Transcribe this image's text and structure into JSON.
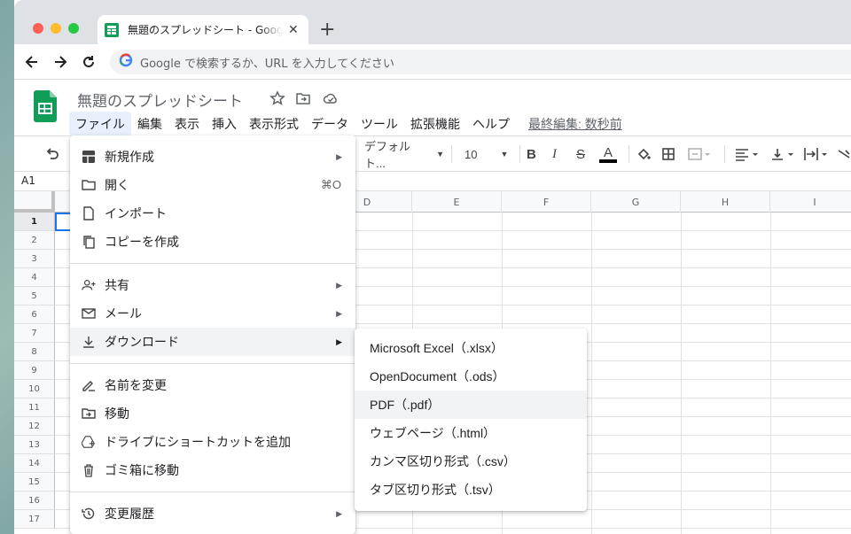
{
  "browser": {
    "tab_title": "無題のスプレッドシート - Google スプレッドシート",
    "tab_close": "✕",
    "new_tab": "+",
    "omnibox_placeholder": "Google で検索するか、URL を入力してください"
  },
  "doc": {
    "title": "無題のスプレッドシート",
    "menus": [
      "ファイル",
      "編集",
      "表示",
      "挿入",
      "表示形式",
      "データ",
      "ツール",
      "拡張機能",
      "ヘルプ"
    ],
    "last_edit": "最終編集: 数秒前"
  },
  "toolbar": {
    "font": "デフォルト...",
    "font_size": "10",
    "text_color": "#000000"
  },
  "namebox": "A1",
  "grid": {
    "columns": [
      "D",
      "E",
      "F",
      "G",
      "H",
      "I"
    ],
    "rows": [
      "1",
      "2",
      "3",
      "4",
      "5",
      "6",
      "7",
      "8",
      "9",
      "10",
      "11",
      "12",
      "13",
      "14",
      "15",
      "16",
      "17"
    ]
  },
  "file_menu": {
    "new": "新規作成",
    "open": "開く",
    "open_shortcut": "⌘O",
    "import": "インポート",
    "copy": "コピーを作成",
    "share": "共有",
    "email": "メール",
    "download": "ダウンロード",
    "rename": "名前を変更",
    "move": "移動",
    "shortcut": "ドライブにショートカットを追加",
    "trash": "ゴミ箱に移動",
    "history": "変更履歴"
  },
  "download_menu": {
    "items": [
      "Microsoft Excel（.xlsx）",
      "OpenDocument（.ods）",
      "PDF（.pdf）",
      "ウェブページ（.html）",
      "カンマ区切り形式（.csv）",
      "タブ区切り形式（.tsv）"
    ]
  },
  "colors": {
    "sheets_green": "#0f9d58",
    "selection_blue": "#1a73e8"
  }
}
